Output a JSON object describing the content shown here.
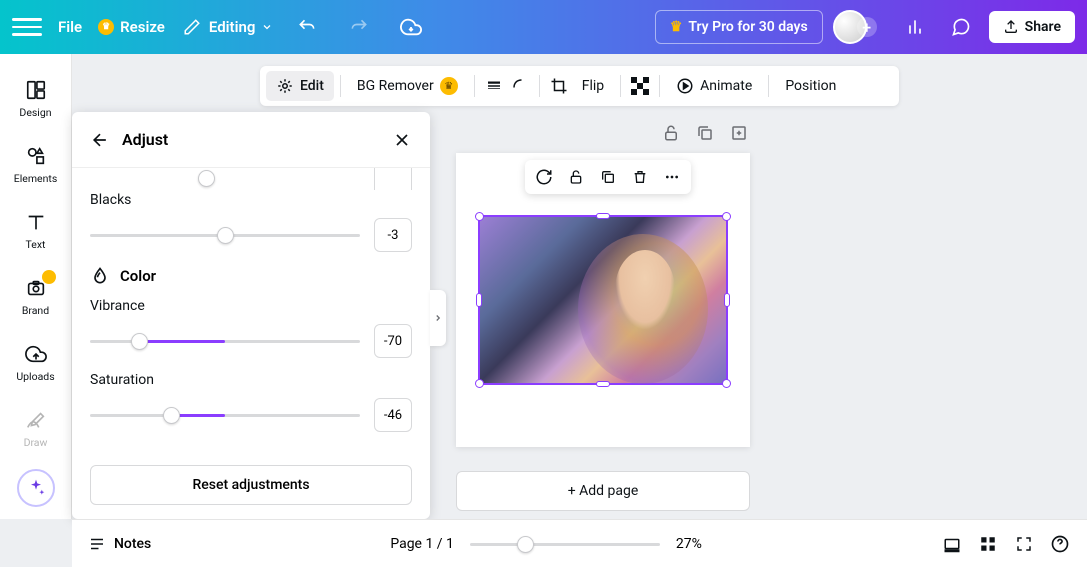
{
  "header": {
    "file": "File",
    "resize": "Resize",
    "editing": "Editing",
    "try_pro": "Try Pro for 30 days",
    "share": "Share"
  },
  "rail": {
    "design": "Design",
    "elements": "Elements",
    "text": "Text",
    "brand": "Brand",
    "uploads": "Uploads",
    "draw": "Draw"
  },
  "ctx": {
    "edit": "Edit",
    "bg_remover": "BG Remover",
    "flip": "Flip",
    "animate": "Animate",
    "position": "Position"
  },
  "adjust": {
    "title": "Adjust",
    "blacks_label": "Blacks",
    "blacks_value": "-3",
    "color_section": "Color",
    "vibrance_label": "Vibrance",
    "vibrance_value": "-70",
    "saturation_label": "Saturation",
    "saturation_value": "-46",
    "reset": "Reset adjustments"
  },
  "canvas": {
    "add_page": "+ Add page"
  },
  "bottom": {
    "notes": "Notes",
    "page_indicator": "Page 1 / 1",
    "zoom": "27%"
  }
}
